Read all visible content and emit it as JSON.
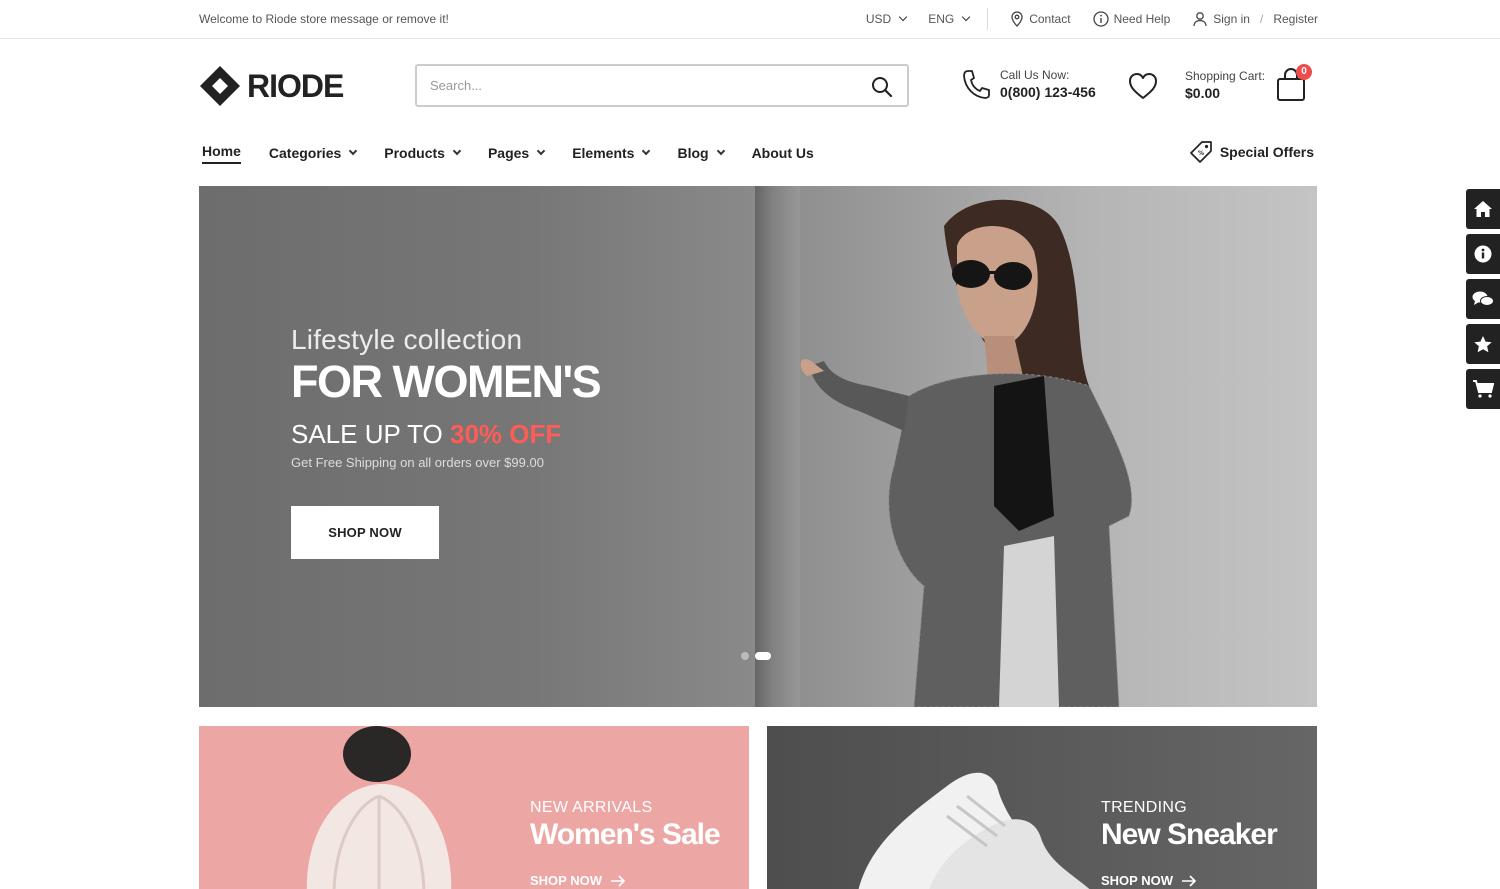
{
  "topbar": {
    "welcome": "Welcome to Riode store message or remove it!",
    "currency": "USD",
    "language": "ENG",
    "contact": "Contact",
    "help": "Need Help",
    "signin": "Sign in",
    "register": "Register"
  },
  "header": {
    "logo": "RIODE",
    "search_placeholder": "Search...",
    "call_label": "Call Us Now:",
    "call_number": "0(800) 123-456",
    "cart_label": "Shopping Cart:",
    "cart_amount": "$0.00",
    "cart_count": "0"
  },
  "nav": {
    "items": [
      {
        "label": "Home"
      },
      {
        "label": "Categories"
      },
      {
        "label": "Products"
      },
      {
        "label": "Pages"
      },
      {
        "label": "Elements"
      },
      {
        "label": "Blog"
      },
      {
        "label": "About Us"
      }
    ],
    "special_offers": "Special Offers"
  },
  "hero": {
    "subtitle": "Lifestyle collection",
    "title": "FOR WOMEN'S",
    "sale_prefix": "SALE UP TO",
    "sale_highlight": "30% OFF",
    "shipping": "Get Free Shipping on all orders over $99.00",
    "button": "SHOP NOW"
  },
  "banners": [
    {
      "kicker": "NEW ARRIVALS",
      "title": "Women's Sale",
      "link": "SHOP NOW"
    },
    {
      "kicker": "TRENDING",
      "title": "New Sneaker",
      "link": "SHOP NOW"
    }
  ],
  "colors": {
    "accent": "#ff5c57",
    "dark": "#222222",
    "pink_banner": "#eca7a5"
  }
}
